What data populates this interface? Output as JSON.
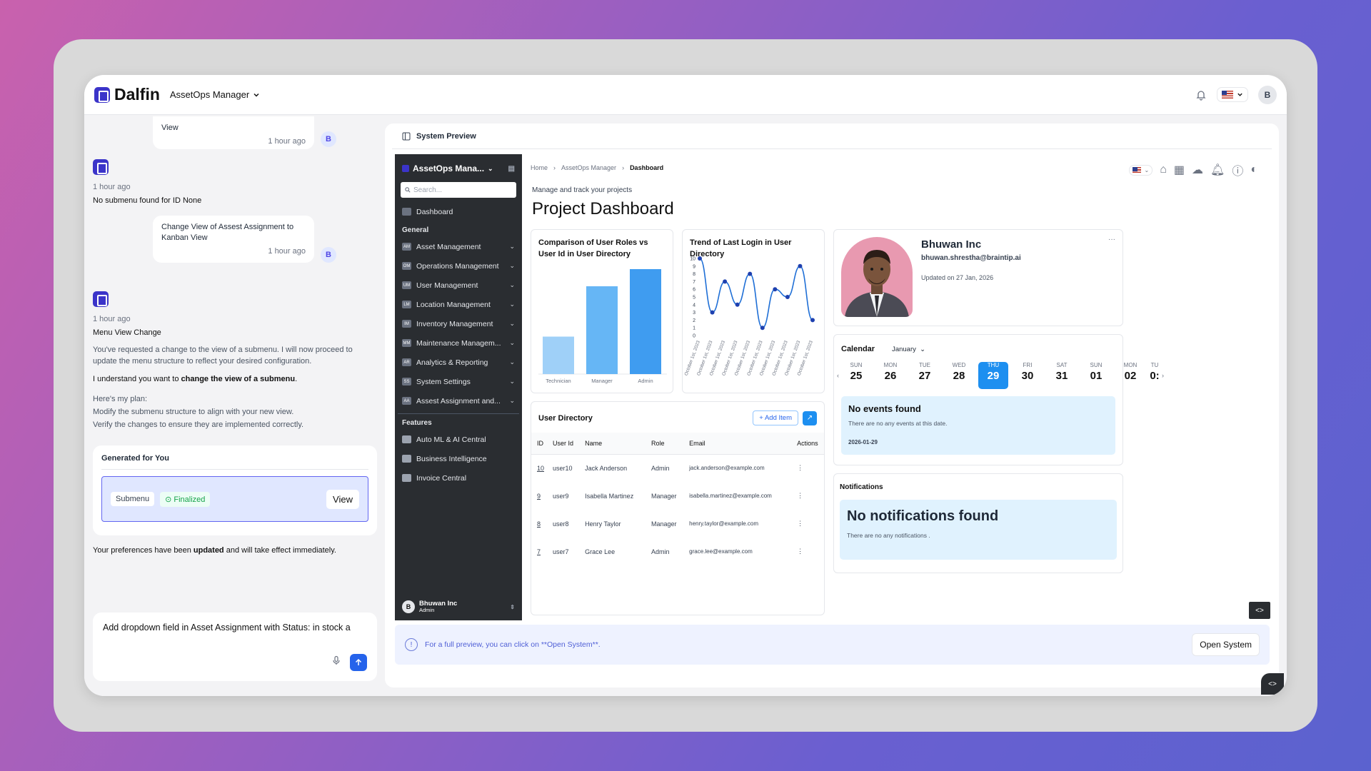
{
  "topbar": {
    "brand": "Dalfin",
    "app_name": "AssetOps Manager",
    "user_initial": "B"
  },
  "chat": {
    "msg1": {
      "text": "View",
      "time": "1 hour ago",
      "initial": "B"
    },
    "bot1": {
      "time": "1 hour ago",
      "text": "No submenu found for ID None"
    },
    "msg2": {
      "text": "Change View of Assest Assignment to Kanban View",
      "time": "1 hour ago",
      "initial": "B"
    },
    "bot2": {
      "time": "1 hour ago",
      "title": "Menu View Change",
      "p1": "You've requested a change to the view of a submenu. I will now proceed to update the menu structure to reflect your desired configuration.",
      "p2_pre": "I understand you want to ",
      "p2_bold": "change the view of a submenu",
      "p2_post": ".",
      "plan_title": "Here's my plan:",
      "plan1": "Modify the submenu structure to align with your new view.",
      "plan2": "Verify the changes to ensure they are implemented correctly."
    },
    "generated": {
      "title": "Generated for You",
      "tag": "Submenu",
      "status": "Finalized",
      "view": "View"
    },
    "pref_pre": "Your preferences have been ",
    "pref_bold": "updated",
    "pref_post": " and will take effect immediately.",
    "input_text": "Add dropdown field in Asset Assignment with Status: in stock a"
  },
  "preview": {
    "title": "System Preview",
    "sidebar": {
      "app": "AssetOps Mana...",
      "search_placeholder": "Search...",
      "dashboard": "Dashboard",
      "general_label": "General",
      "general": [
        {
          "abbr": "AM",
          "label": "Asset Management"
        },
        {
          "abbr": "OM",
          "label": "Operations Management"
        },
        {
          "abbr": "UM",
          "label": "User Management"
        },
        {
          "abbr": "LM",
          "label": "Location Management"
        },
        {
          "abbr": "IM",
          "label": "Inventory Management"
        },
        {
          "abbr": "MM",
          "label": "Maintenance Managem..."
        },
        {
          "abbr": "AR",
          "label": "Analytics & Reporting"
        },
        {
          "abbr": "SS",
          "label": "System Settings"
        },
        {
          "abbr": "AA",
          "label": "Assest Assignment and..."
        }
      ],
      "features_label": "Features",
      "features": [
        "Auto ML & AI Central",
        "Business Intelligence",
        "Invoice Central"
      ],
      "user": {
        "initial": "B",
        "name": "Bhuwan Inc",
        "role": "Admin"
      }
    },
    "breadcrumb": [
      "Home",
      "AssetOps Manager",
      "Dashboard"
    ],
    "subtitle": "Manage and track your projects",
    "page_title": "Project Dashboard",
    "profile": {
      "name": "Bhuwan Inc",
      "email": "bhuwan.shrestha@braintip.ai",
      "updated": "Updated on 27 Jan, 2026",
      "more": "···"
    },
    "calendar": {
      "label": "Calendar",
      "month": "January",
      "days": [
        {
          "dn": "SUN",
          "dd": "25"
        },
        {
          "dn": "MON",
          "dd": "26"
        },
        {
          "dn": "TUE",
          "dd": "27"
        },
        {
          "dn": "WED",
          "dd": "28"
        },
        {
          "dn": "THU",
          "dd": "29"
        },
        {
          "dn": "FRI",
          "dd": "30"
        },
        {
          "dn": "SAT",
          "dd": "31"
        },
        {
          "dn": "SUN",
          "dd": "01"
        },
        {
          "dn": "MON",
          "dd": "02"
        },
        {
          "dn": "TU",
          "dd": "0:"
        }
      ],
      "selected_index": 4,
      "empty_title": "No events found",
      "empty_text": "There are no any events at this date.",
      "date": "2026-01-29"
    },
    "notifications": {
      "label": "Notifications",
      "title": "No notifications found",
      "text": "There are no any notifications ."
    },
    "user_directory": {
      "title": "User Directory",
      "add": "Add Item",
      "columns": [
        "ID",
        "User Id",
        "Name",
        "Role",
        "Email",
        "Actions"
      ],
      "rows": [
        [
          "10",
          "user10",
          "Jack Anderson",
          "Admin",
          "jack.anderson@example.com"
        ],
        [
          "9",
          "user9",
          "Isabella Martinez",
          "Manager",
          "isabella.martinez@example.com"
        ],
        [
          "8",
          "user8",
          "Henry Taylor",
          "Manager",
          "henry.taylor@example.com"
        ],
        [
          "7",
          "user7",
          "Grace Lee",
          "Admin",
          "grace.lee@example.com"
        ]
      ]
    },
    "footer_note": "For a full preview, you can click on **Open System**.",
    "open_system": "Open System",
    "code_glyph": "<>"
  },
  "chart_data": [
    {
      "type": "bar",
      "title": "Comparison of User Roles vs User Id in User Directory",
      "categories": [
        "Technician",
        "Manager",
        "Admin"
      ],
      "values": [
        3.5,
        8.2,
        9.8
      ],
      "ylim": [
        0,
        10
      ],
      "color": "#4aa3f0"
    },
    {
      "type": "line",
      "title": "Trend of Last Login in User Directory",
      "yticks": [
        "0",
        "1",
        "2",
        "3",
        "4",
        "5",
        "6",
        "7",
        "8",
        "9",
        "10"
      ],
      "ylim": [
        0,
        10
      ],
      "xlabels": [
        "October 1st, 2023",
        "October 1st, 2023",
        "October 1st, 2023",
        "October 1st, 2023",
        "October 1st, 2023",
        "October 1st, 2023",
        "October 1st, 2023",
        "October 1st, 2023",
        "October 1st, 2023",
        "October 1st, 2023"
      ],
      "values": [
        10,
        3,
        7,
        4,
        8,
        1,
        6,
        5,
        9,
        2
      ],
      "color": "#1f6fd6"
    }
  ]
}
